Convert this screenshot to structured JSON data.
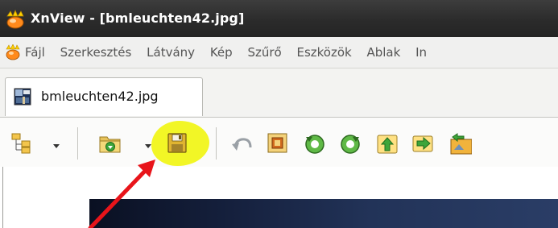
{
  "window": {
    "title": "XnView - [bmleuchten42.jpg]",
    "app_icon": "xnview-icon"
  },
  "menu": {
    "icon": "xnview-small-icon",
    "items": [
      "Fájl",
      "Szerkesztés",
      "Látvány",
      "Kép",
      "Szűrő",
      "Eszközök",
      "Ablak",
      "In"
    ]
  },
  "tabs": [
    {
      "label": "bmleuchten42.jpg",
      "icon": "image-thumbnail-icon"
    }
  ],
  "toolbar": {
    "tools": [
      {
        "name": "tree-view-icon"
      },
      {
        "name": "open-folder-icon"
      },
      {
        "name": "save-icon"
      },
      {
        "name": "undo-icon"
      },
      {
        "name": "crop-icon"
      },
      {
        "name": "rotate-left-icon"
      },
      {
        "name": "rotate-right-icon"
      },
      {
        "name": "move-up-icon"
      },
      {
        "name": "next-icon"
      },
      {
        "name": "batch-icon"
      }
    ],
    "highlight_color": "#f0f500"
  },
  "annotation": {
    "arrow_color": "#e8141a"
  }
}
